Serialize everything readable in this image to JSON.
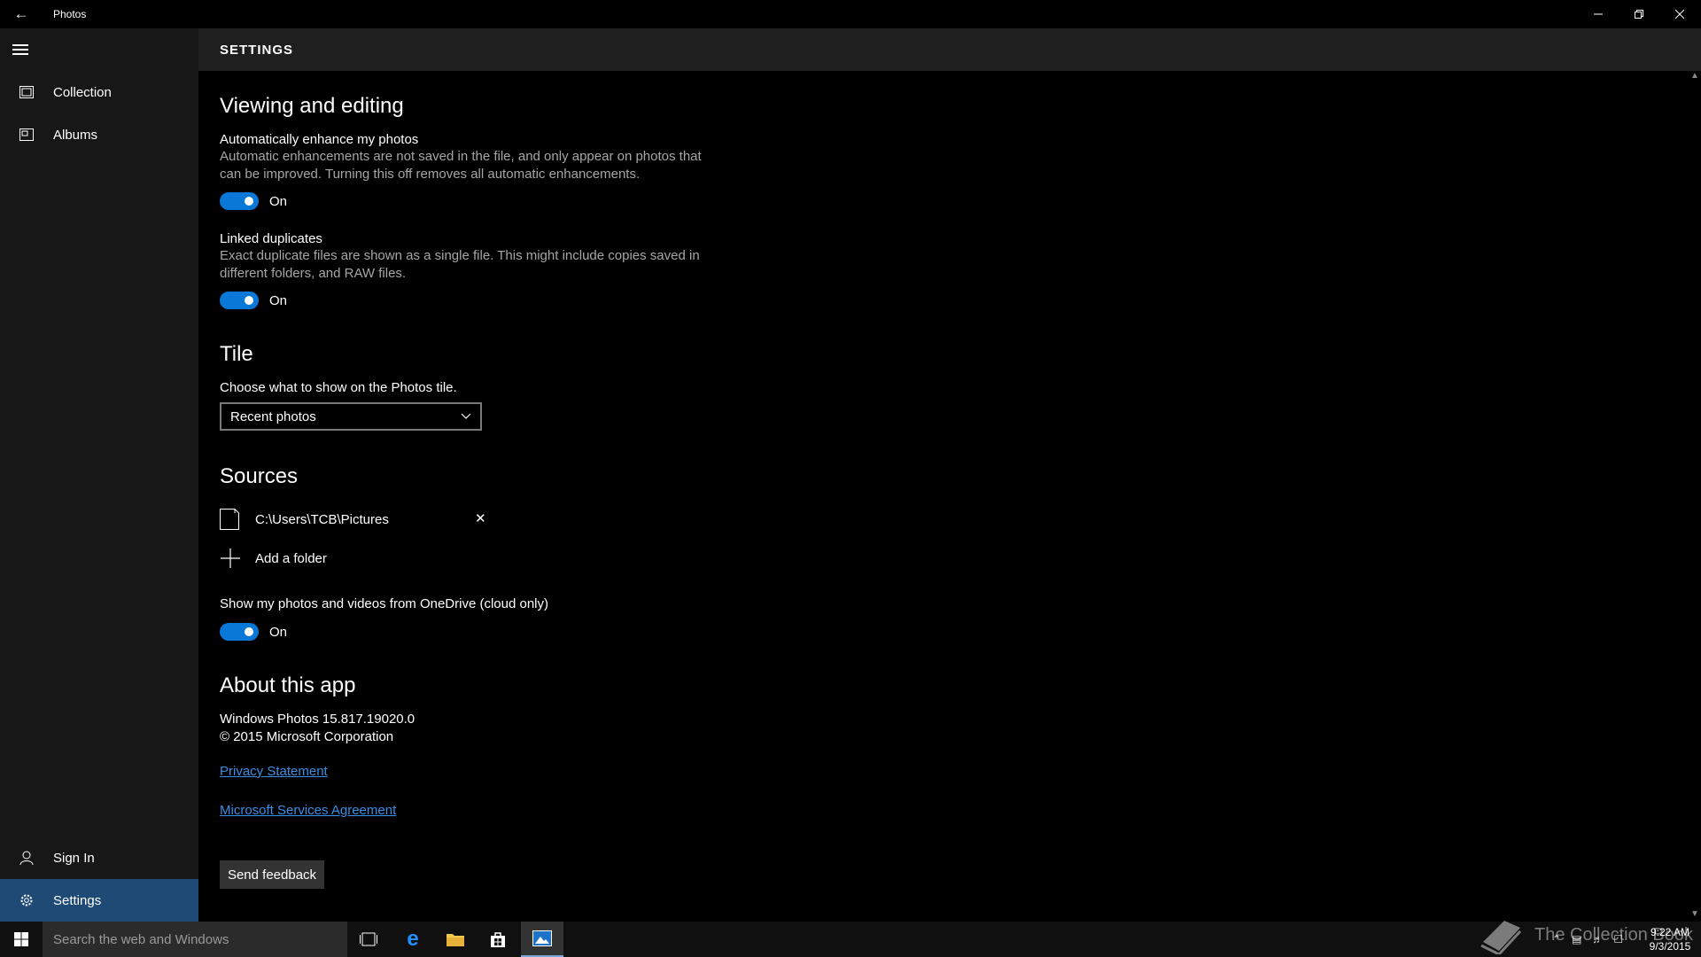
{
  "window": {
    "title": "Photos"
  },
  "sidebar": {
    "items": [
      {
        "label": "Collection",
        "icon": "collection-icon"
      },
      {
        "label": "Albums",
        "icon": "albums-icon"
      }
    ],
    "bottom_items": [
      {
        "label": "Sign In",
        "icon": "person-icon"
      },
      {
        "label": "Settings",
        "icon": "gear-icon",
        "active": true
      }
    ]
  },
  "header": {
    "title": "SETTINGS"
  },
  "viewing": {
    "title": "Viewing and editing",
    "enhance": {
      "label": "Automatically enhance my photos",
      "desc": "Automatic enhancements are not saved in the file, and only appear on photos that can be improved. Turning this off removes all automatic enhancements.",
      "state": "On"
    },
    "duplicates": {
      "label": "Linked duplicates",
      "desc": "Exact duplicate files are shown as a single file. This might include copies saved in different folders, and RAW files.",
      "state": "On"
    }
  },
  "tile": {
    "title": "Tile",
    "label": "Choose what to show on the Photos tile.",
    "selected": "Recent photos"
  },
  "sources": {
    "title": "Sources",
    "folder": "C:\\Users\\TCB\\Pictures",
    "add_label": "Add a folder",
    "onedrive": {
      "label": "Show my photos and videos from OneDrive (cloud only)",
      "state": "On"
    }
  },
  "about": {
    "title": "About this app",
    "version": "Windows Photos 15.817.19020.0",
    "copyright": "© 2015 Microsoft Corporation",
    "privacy_link": "Privacy Statement",
    "agreement_link": "Microsoft Services Agreement",
    "feedback_button": "Send feedback"
  },
  "taskbar": {
    "search_placeholder": "Search the web and Windows",
    "time": "9:22 AM",
    "date": "9/3/2015"
  },
  "watermark": "The Collection Book",
  "colors": {
    "accent": "#0a78d7",
    "active_nav": "#1f4a75",
    "link": "#3b8ee5"
  }
}
